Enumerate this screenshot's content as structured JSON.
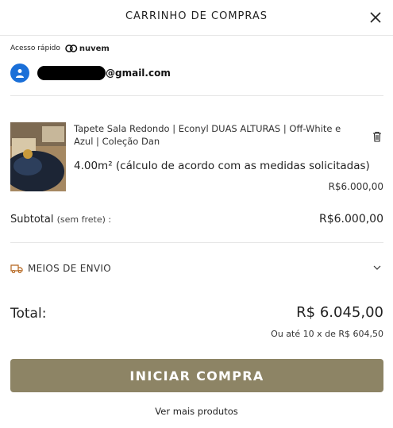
{
  "header": {
    "title": "CARRINHO DE COMPRAS",
    "close_icon": "close-icon"
  },
  "quick_access": {
    "label": "Acesso rápido",
    "brand": "nuvem"
  },
  "account": {
    "email_suffix": "@gmail.com"
  },
  "item": {
    "name": "Tapete Sala Redondo | Econyl DUAS ALTURAS | Off-White e Azul | Coleção Dan",
    "measure": "4.00m² (cálculo de acordo com as medidas solicitadas)",
    "price": "R$6.000,00"
  },
  "subtotal": {
    "label": "Subtotal",
    "note": "(sem frete) :",
    "value": "R$6.000,00"
  },
  "shipping": {
    "label": "MEIOS DE ENVIO"
  },
  "total": {
    "label": "Total:",
    "value": "R$ 6.045,00",
    "installments": "Ou até 10 x de R$ 604,50"
  },
  "actions": {
    "checkout": "INICIAR COMPRA",
    "more": "Ver mais produtos"
  },
  "colors": {
    "accent": "#8d8465",
    "avatar": "#1a6fd8",
    "shipping_icon": "#b5651d"
  }
}
